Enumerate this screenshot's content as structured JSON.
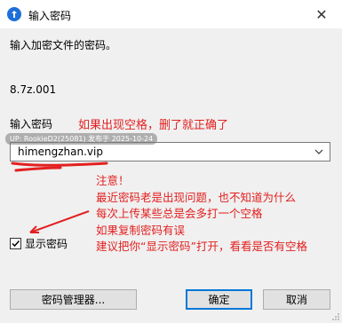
{
  "window": {
    "title": "输入密码",
    "close_glyph": "✕"
  },
  "prompt": "输入加密文件的密码。",
  "filename": "8.7z.001",
  "password": {
    "label": "输入密码",
    "value": "himengzhan.vip",
    "dropdown_icon": "chevron-down-icon"
  },
  "watermark": "UP: RookieD2(25081) 发布于 2025-10-24",
  "annotations": {
    "hint_top": "如果出现空格，删了就正确了",
    "note_lines": [
      "注意！",
      "最近密码老是出现问题，也不知道为什么",
      "每次上传某些总是会多打一个空格",
      "如果复制密码有误",
      "建议把你“显示密码”打开，看看是否有空格"
    ],
    "color": "#e32020"
  },
  "show_password": {
    "label": "显示密码",
    "checked": true
  },
  "buttons": {
    "manager": "密码管理器...",
    "ok": "确定",
    "cancel": "取消"
  },
  "colors": {
    "accent": "#0078d7",
    "annotation": "#e32020",
    "window_bg": "#f0f0f0"
  }
}
